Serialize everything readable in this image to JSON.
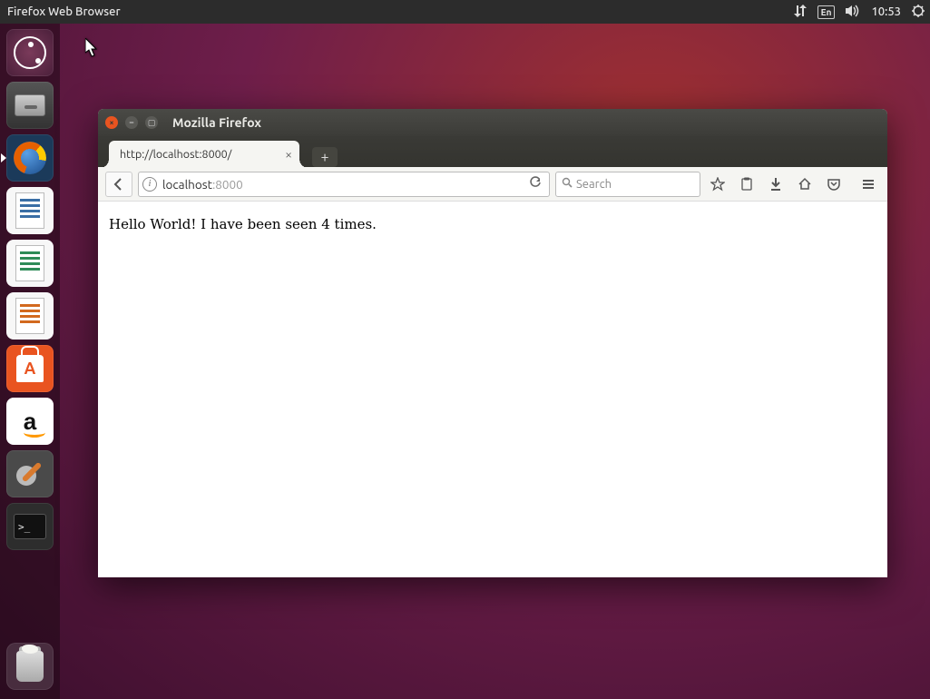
{
  "menubar": {
    "app_title": "Firefox Web Browser",
    "indicators": {
      "input_lang": "En",
      "time": "10:53"
    }
  },
  "launcher": {
    "items": {
      "dash": "dash-home",
      "files": "files",
      "firefox": "firefox",
      "writer": "libreoffice-writer",
      "calc": "libreoffice-calc",
      "impress": "libreoffice-impress",
      "software": "ubuntu-software",
      "amazon": "amazon",
      "settings": "system-settings",
      "terminal": "terminal",
      "trash": "trash"
    },
    "terminal_prompt_glyph": ">_"
  },
  "firefox": {
    "window_title": "Mozilla Firefox",
    "tab": {
      "title": "http://localhost:8000/"
    },
    "url": {
      "host": "localhost",
      "port": ":8000"
    },
    "search_placeholder": "Search",
    "page_text": "Hello World! I have been seen 4 times."
  }
}
